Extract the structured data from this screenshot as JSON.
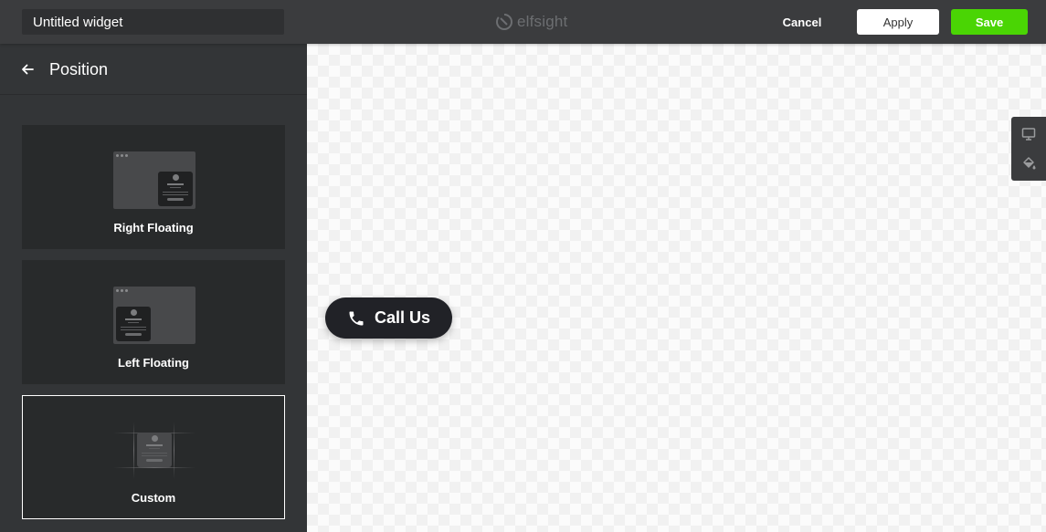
{
  "topbar": {
    "widget_name": "Untitled widget",
    "logo_text": "elfsight",
    "cancel_label": "Cancel",
    "apply_label": "Apply",
    "save_label": "Save"
  },
  "panel": {
    "title": "Position",
    "options": [
      {
        "label": "Right Floating",
        "selected": false
      },
      {
        "label": "Left Floating",
        "selected": false
      },
      {
        "label": "Custom",
        "selected": true
      }
    ]
  },
  "preview": {
    "call_button_label": "Call Us",
    "tools": [
      "desktop-icon",
      "paint-bucket-icon"
    ]
  },
  "colors": {
    "accent_save": "#4ad504",
    "topbar": "#3b3c3e",
    "sidebar": "#333537",
    "option_card": "#282a2b",
    "call_button": "#212227"
  }
}
